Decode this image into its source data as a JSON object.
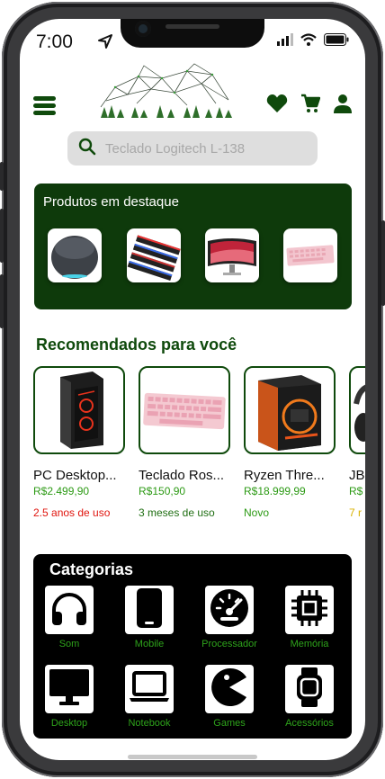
{
  "status": {
    "time": "7:00"
  },
  "search": {
    "placeholder": "Teclado Logitech L-138"
  },
  "featured": {
    "title": "Produtos em destaque",
    "items": [
      {
        "name": "smart-speaker"
      },
      {
        "name": "ram-memory"
      },
      {
        "name": "curved-monitor"
      },
      {
        "name": "pink-keyboard"
      }
    ]
  },
  "recommended": {
    "title": "Recomendados para você",
    "items": [
      {
        "name": "PC Desktop...",
        "price": "R$2.499,90",
        "condition": "2.5 anos de uso",
        "condition_color": "#e0140d"
      },
      {
        "name": "Teclado Ros...",
        "price": "R$150,90",
        "condition": "3 meses de uso",
        "condition_color": "#1f6e12"
      },
      {
        "name": "Ryzen Thre...",
        "price": "R$18.999,99",
        "condition": "Novo",
        "condition_color": "#2c9a14"
      },
      {
        "name": "JB",
        "price": "R$",
        "condition": "7 r",
        "condition_color": "#d9b200"
      }
    ]
  },
  "categories": {
    "title": "Categorias",
    "items": [
      {
        "label": "Som",
        "icon": "headphones-icon"
      },
      {
        "label": "Mobile",
        "icon": "smartphone-icon"
      },
      {
        "label": "Processador",
        "icon": "speedometer-icon"
      },
      {
        "label": "Memória",
        "icon": "chip-icon"
      },
      {
        "label": "Desktop",
        "icon": "monitor-icon"
      },
      {
        "label": "Notebook",
        "icon": "laptop-icon"
      },
      {
        "label": "Games",
        "icon": "pacman-icon"
      },
      {
        "label": "Acessórios",
        "icon": "smartwatch-icon"
      }
    ]
  },
  "colors": {
    "brand_green": "#0f4a0c",
    "price_green": "#2c9a14",
    "search_bg": "#dedede"
  }
}
